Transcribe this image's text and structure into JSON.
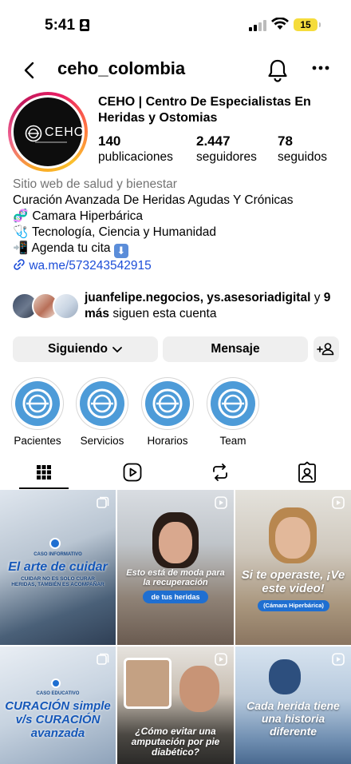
{
  "status_bar": {
    "time": "5:41",
    "battery": "15"
  },
  "header": {
    "username": "ceho_colombia"
  },
  "profile": {
    "logo_text": "CEHO",
    "full_name": "CEHO | Centro De Especialistas En Heridas y Ostomias",
    "stats": [
      {
        "value": "140",
        "label": "publicaciones"
      },
      {
        "value": "2.447",
        "label": "seguidores"
      },
      {
        "value": "78",
        "label": "seguidos"
      }
    ],
    "category": "Sitio web de salud y bienestar",
    "bio_lines": [
      {
        "emoji": "🧬",
        "text": "Curación Avanzada De Heridas Agudas Y Crónicas"
      },
      {
        "emoji": "🧬",
        "text": "Camara Hiperbárica"
      },
      {
        "emoji": "🩺",
        "text": "Tecnología, Ciencia y Humanidad"
      },
      {
        "emoji": "📲",
        "text": "Agenda tu cita"
      }
    ],
    "link": "wa.me/573243542915"
  },
  "followed_by": {
    "names": "juanfelipe.negocios, ys.asesoriadigital",
    "connector": "y",
    "more": "9 más",
    "suffix": "siguen esta cuenta"
  },
  "actions": {
    "following": "Siguiendo",
    "message": "Mensaje"
  },
  "highlights": [
    {
      "label": "Pacientes"
    },
    {
      "label": "Servicios"
    },
    {
      "label": "Horarios"
    },
    {
      "label": "Team"
    }
  ],
  "posts": [
    {
      "small": "CASO INFORMATIVO",
      "title": "El arte de cuidar",
      "caption": "CUIDAR NO ES SOLO CURAR HERIDAS, TAMBIÉN ES ACOMPAÑAR"
    },
    {
      "title": "Esto está de moda para la recuperación",
      "pill": "de tus heridas"
    },
    {
      "title": "Si te operaste, ¡Ve este video!",
      "pill": "(Cámara Hiperbárica)"
    },
    {
      "small": "CASO EDUCATIVO",
      "title": "CURACIÓN simple v/s CURACIÓN avanzada"
    },
    {
      "title": "¿Cómo evitar una amputación por pie diabético?"
    },
    {
      "title": "Cada herida tiene una historia diferente"
    }
  ],
  "colors": {
    "accent_link": "#1d4ed8",
    "highlight_blue": "#4d9bd8",
    "button_gray": "#efefef"
  }
}
